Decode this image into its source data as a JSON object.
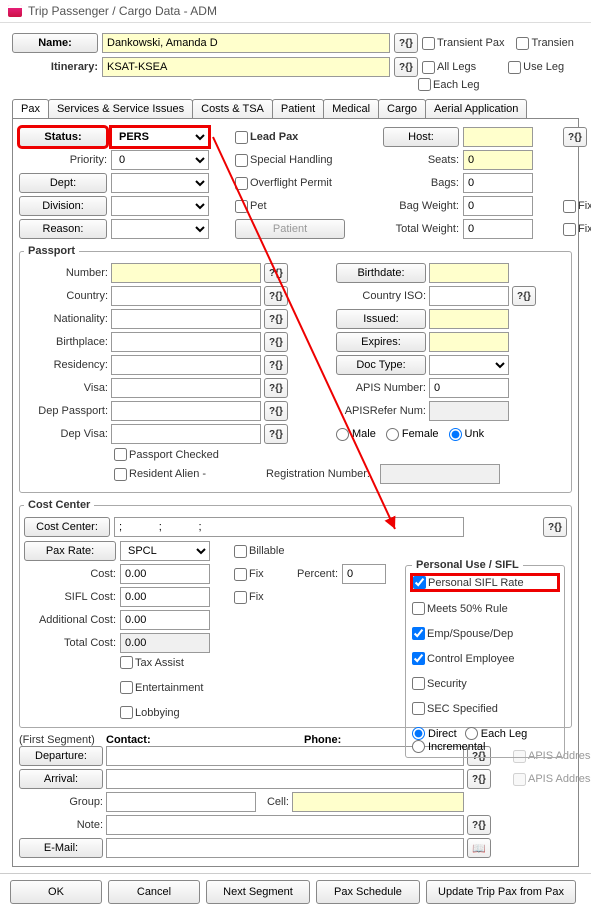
{
  "window": {
    "title": "Trip Passenger / Cargo Data - ADM"
  },
  "header": {
    "name_btn": "Name:",
    "name_val": "Dankowski, Amanda D",
    "itin_lbl": "Itinerary:",
    "itin_val": "KSAT-KSEA",
    "transient_pax": "Transient Pax",
    "all_legs": "All Legs",
    "each_leg": "Each Leg",
    "transien_cut": "Transien",
    "use_leg": "Use Leg"
  },
  "tabs": [
    "Pax",
    "Services & Service Issues",
    "Costs & TSA",
    "Patient",
    "Medical",
    "Cargo",
    "Aerial Application"
  ],
  "pax": {
    "status_lbl": "Status:",
    "status_val": "PERS",
    "leadpax": "Lead Pax",
    "host_btn": "Host:",
    "priority_lbl": "Priority:",
    "priority_val": "0",
    "special": "Special Handling",
    "seats_lbl": "Seats:",
    "seats_val": "0",
    "dept_btn": "Dept:",
    "overflight": "Overflight Permit",
    "bags_lbl": "Bags:",
    "bags_val": "0",
    "division_btn": "Division:",
    "pet": "Pet",
    "bagwt_lbl": "Bag Weight:",
    "bagwt_val": "0",
    "fix": "Fix",
    "reason_btn": "Reason:",
    "patient_btn": "Patient",
    "totwt_lbl": "Total Weight:",
    "totwt_val": "0"
  },
  "passport": {
    "legend": "Passport",
    "number": "Number:",
    "country": "Country:",
    "nationality": "Nationality:",
    "birthplace": "Birthplace:",
    "residency": "Residency:",
    "visa": "Visa:",
    "dep_passport": "Dep Passport:",
    "dep_visa": "Dep Visa:",
    "birthdate_btn": "Birthdate:",
    "country_iso": "Country ISO:",
    "issued_btn": "Issued:",
    "expires_btn": "Expires:",
    "doctype_btn": "Doc Type:",
    "apis_num": "APIS Number:",
    "apis_num_val": "0",
    "apis_ref": "APISRefer Num:",
    "male": "Male",
    "female": "Female",
    "unk": "Unk",
    "passport_checked": "Passport Checked",
    "resident_alien": "Resident Alien  -",
    "reg_num": "Registration Number:"
  },
  "cost": {
    "legend": "Cost Center",
    "cc_btn": "Cost Center:",
    "cc_val": ";            ;            ;",
    "paxrate_btn": "Pax Rate:",
    "paxrate_val": "SPCL",
    "billable": "Billable",
    "cost_lbl": "Cost:",
    "cost_val": "0.00",
    "fix": "Fix",
    "percent": "Percent:",
    "percent_val": "0",
    "sifl_cost_lbl": "SIFL Cost:",
    "sifl_cost_val": "0.00",
    "addl_lbl": "Additional Cost:",
    "addl_val": "0.00",
    "total_lbl": "Total Cost:",
    "total_val": "0.00",
    "tax_assist": "Tax Assist",
    "entertainment": "Entertainment",
    "lobbying": "Lobbying"
  },
  "sifl": {
    "legend": "Personal Use / SIFL",
    "personal": "Personal SIFL Rate",
    "meets50": "Meets 50% Rule",
    "empspouse": "Emp/Spouse/Dep",
    "control": "Control Employee",
    "security": "Security",
    "secspec": "SEC Specified",
    "direct": "Direct",
    "eachleg": "Each Leg",
    "incremental": "Incremental"
  },
  "seg": {
    "hdr": "(First Segment)",
    "contact": "Contact:",
    "phone": "Phone:",
    "departure_btn": "Departure:",
    "arrival_btn": "Arrival:",
    "group": "Group:",
    "cell": "Cell:",
    "note": "Note:",
    "email_btn": "E-Mail:",
    "apis_addr": "APIS Address"
  },
  "footer": {
    "ok": "OK",
    "cancel": "Cancel",
    "next": "Next Segment",
    "sched": "Pax Schedule",
    "update": "Update Trip Pax from Pax"
  }
}
